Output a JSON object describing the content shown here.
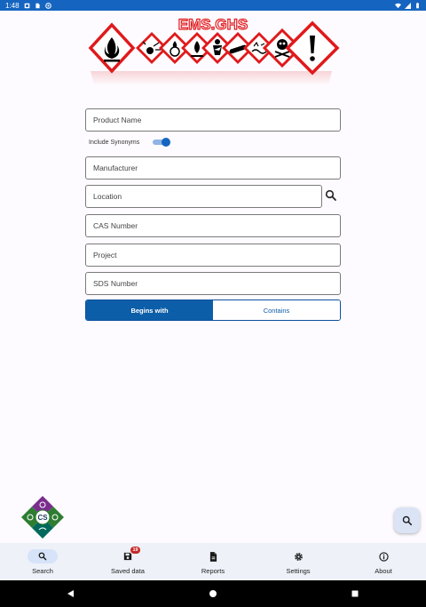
{
  "status_bar": {
    "time": "1:48"
  },
  "logo": {
    "text": "EMS.GHS"
  },
  "form": {
    "product_name_placeholder": "Product Name",
    "include_synonyms_label": "Include Synonyms",
    "include_synonyms_on": true,
    "manufacturer_placeholder": "Manufacturer",
    "location_placeholder": "Location",
    "cas_placeholder": "CAS Number",
    "project_placeholder": "Project",
    "sds_placeholder": "SDS Number"
  },
  "match_mode": {
    "options": [
      "Begins with",
      "Contains"
    ],
    "selected": "Begins with"
  },
  "company_logo": {
    "text": "CS"
  },
  "bottom_nav": {
    "items": [
      {
        "label": "Search",
        "icon": "search-icon",
        "active": true
      },
      {
        "label": "Saved data",
        "icon": "save-icon",
        "badge": "19"
      },
      {
        "label": "Reports",
        "icon": "document-icon"
      },
      {
        "label": "Settings",
        "icon": "gear-icon"
      },
      {
        "label": "About",
        "icon": "info-icon"
      }
    ]
  },
  "colors": {
    "primary": "#1565c0",
    "segment_active": "#0d5ea8",
    "ghs_red": "#e0191c",
    "badge": "#c62828"
  }
}
